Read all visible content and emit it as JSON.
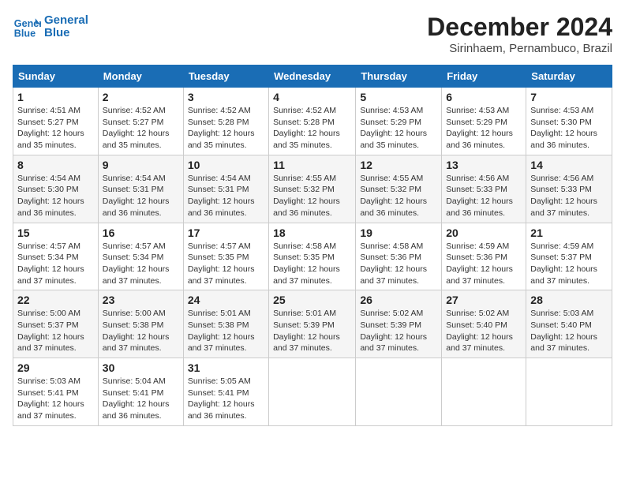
{
  "header": {
    "logo_line1": "General",
    "logo_line2": "Blue",
    "month_title": "December 2024",
    "subtitle": "Sirinhaem, Pernambuco, Brazil"
  },
  "weekdays": [
    "Sunday",
    "Monday",
    "Tuesday",
    "Wednesday",
    "Thursday",
    "Friday",
    "Saturday"
  ],
  "weeks": [
    [
      {
        "day": "1",
        "sunrise": "4:51 AM",
        "sunset": "5:27 PM",
        "daylight": "12 hours and 35 minutes."
      },
      {
        "day": "2",
        "sunrise": "4:52 AM",
        "sunset": "5:27 PM",
        "daylight": "12 hours and 35 minutes."
      },
      {
        "day": "3",
        "sunrise": "4:52 AM",
        "sunset": "5:28 PM",
        "daylight": "12 hours and 35 minutes."
      },
      {
        "day": "4",
        "sunrise": "4:52 AM",
        "sunset": "5:28 PM",
        "daylight": "12 hours and 35 minutes."
      },
      {
        "day": "5",
        "sunrise": "4:53 AM",
        "sunset": "5:29 PM",
        "daylight": "12 hours and 35 minutes."
      },
      {
        "day": "6",
        "sunrise": "4:53 AM",
        "sunset": "5:29 PM",
        "daylight": "12 hours and 36 minutes."
      },
      {
        "day": "7",
        "sunrise": "4:53 AM",
        "sunset": "5:30 PM",
        "daylight": "12 hours and 36 minutes."
      }
    ],
    [
      {
        "day": "8",
        "sunrise": "4:54 AM",
        "sunset": "5:30 PM",
        "daylight": "12 hours and 36 minutes."
      },
      {
        "day": "9",
        "sunrise": "4:54 AM",
        "sunset": "5:31 PM",
        "daylight": "12 hours and 36 minutes."
      },
      {
        "day": "10",
        "sunrise": "4:54 AM",
        "sunset": "5:31 PM",
        "daylight": "12 hours and 36 minutes."
      },
      {
        "day": "11",
        "sunrise": "4:55 AM",
        "sunset": "5:32 PM",
        "daylight": "12 hours and 36 minutes."
      },
      {
        "day": "12",
        "sunrise": "4:55 AM",
        "sunset": "5:32 PM",
        "daylight": "12 hours and 36 minutes."
      },
      {
        "day": "13",
        "sunrise": "4:56 AM",
        "sunset": "5:33 PM",
        "daylight": "12 hours and 36 minutes."
      },
      {
        "day": "14",
        "sunrise": "4:56 AM",
        "sunset": "5:33 PM",
        "daylight": "12 hours and 37 minutes."
      }
    ],
    [
      {
        "day": "15",
        "sunrise": "4:57 AM",
        "sunset": "5:34 PM",
        "daylight": "12 hours and 37 minutes."
      },
      {
        "day": "16",
        "sunrise": "4:57 AM",
        "sunset": "5:34 PM",
        "daylight": "12 hours and 37 minutes."
      },
      {
        "day": "17",
        "sunrise": "4:57 AM",
        "sunset": "5:35 PM",
        "daylight": "12 hours and 37 minutes."
      },
      {
        "day": "18",
        "sunrise": "4:58 AM",
        "sunset": "5:35 PM",
        "daylight": "12 hours and 37 minutes."
      },
      {
        "day": "19",
        "sunrise": "4:58 AM",
        "sunset": "5:36 PM",
        "daylight": "12 hours and 37 minutes."
      },
      {
        "day": "20",
        "sunrise": "4:59 AM",
        "sunset": "5:36 PM",
        "daylight": "12 hours and 37 minutes."
      },
      {
        "day": "21",
        "sunrise": "4:59 AM",
        "sunset": "5:37 PM",
        "daylight": "12 hours and 37 minutes."
      }
    ],
    [
      {
        "day": "22",
        "sunrise": "5:00 AM",
        "sunset": "5:37 PM",
        "daylight": "12 hours and 37 minutes."
      },
      {
        "day": "23",
        "sunrise": "5:00 AM",
        "sunset": "5:38 PM",
        "daylight": "12 hours and 37 minutes."
      },
      {
        "day": "24",
        "sunrise": "5:01 AM",
        "sunset": "5:38 PM",
        "daylight": "12 hours and 37 minutes."
      },
      {
        "day": "25",
        "sunrise": "5:01 AM",
        "sunset": "5:39 PM",
        "daylight": "12 hours and 37 minutes."
      },
      {
        "day": "26",
        "sunrise": "5:02 AM",
        "sunset": "5:39 PM",
        "daylight": "12 hours and 37 minutes."
      },
      {
        "day": "27",
        "sunrise": "5:02 AM",
        "sunset": "5:40 PM",
        "daylight": "12 hours and 37 minutes."
      },
      {
        "day": "28",
        "sunrise": "5:03 AM",
        "sunset": "5:40 PM",
        "daylight": "12 hours and 37 minutes."
      }
    ],
    [
      {
        "day": "29",
        "sunrise": "5:03 AM",
        "sunset": "5:41 PM",
        "daylight": "12 hours and 37 minutes."
      },
      {
        "day": "30",
        "sunrise": "5:04 AM",
        "sunset": "5:41 PM",
        "daylight": "12 hours and 36 minutes."
      },
      {
        "day": "31",
        "sunrise": "5:05 AM",
        "sunset": "5:41 PM",
        "daylight": "12 hours and 36 minutes."
      },
      null,
      null,
      null,
      null
    ]
  ]
}
